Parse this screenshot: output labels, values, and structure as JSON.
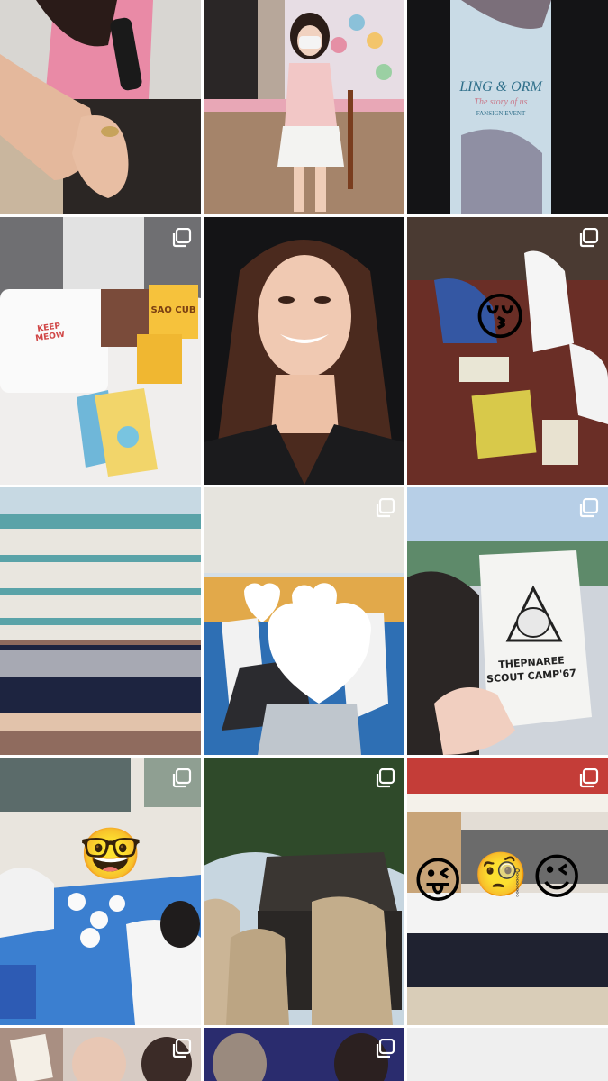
{
  "grid": {
    "posts": [
      {
        "id": "post-1",
        "subject": "hand-with-microphone",
        "multi": false
      },
      {
        "id": "post-2",
        "subject": "girl-posing-at-event",
        "multi": false
      },
      {
        "id": "post-3",
        "subject": "event-banner",
        "multi": false,
        "banner": {
          "title": "LING & ORM",
          "subtitle": "The story of us",
          "event": "FANSIGN EVENT"
        }
      },
      {
        "id": "post-4",
        "subject": "gift-items",
        "multi": true,
        "box_label": "SAO CUB",
        "pouch_text": "KEEP MEOW"
      },
      {
        "id": "post-5",
        "subject": "smiling-portrait",
        "multi": false
      },
      {
        "id": "post-6",
        "subject": "board-game-students",
        "multi": true,
        "emoji": "😚"
      },
      {
        "id": "post-7",
        "subject": "school-group-photo",
        "multi": false
      },
      {
        "id": "post-8",
        "subject": "friends-on-court",
        "multi": true
      },
      {
        "id": "post-9",
        "subject": "scout-camp-card",
        "multi": true,
        "card": {
          "line1": "THEPNAREE",
          "line2": "SCOUT CAMP'67"
        }
      },
      {
        "id": "post-10",
        "subject": "lunch-table",
        "multi": true,
        "emoji": "🤓"
      },
      {
        "id": "post-11",
        "subject": "scouts-outdoors",
        "multi": true
      },
      {
        "id": "post-12",
        "subject": "students-in-hall",
        "multi": true,
        "emojis": [
          "😜",
          "🧐",
          "😉"
        ]
      },
      {
        "id": "post-13",
        "subject": "selfie-collage",
        "multi": true
      },
      {
        "id": "post-14",
        "subject": "concert-portraits",
        "multi": true
      },
      {
        "id": "post-15",
        "subject": "blank",
        "multi": false
      }
    ]
  },
  "icons": {
    "multi_post": "carousel-stack-icon"
  },
  "colors": {
    "background": "#ffffff",
    "icon": "#ffffff"
  }
}
